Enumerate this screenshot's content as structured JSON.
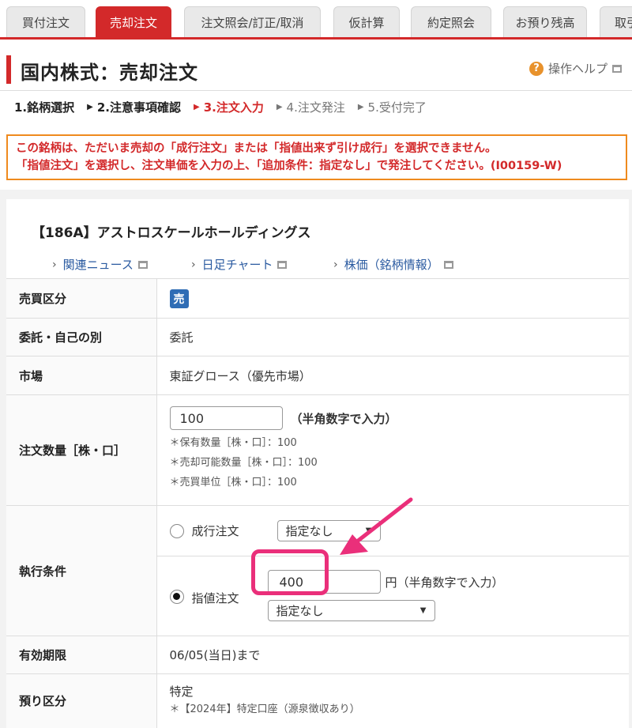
{
  "tabs": [
    {
      "label": "買付注文",
      "active": false
    },
    {
      "label": "売却注文",
      "active": true
    },
    {
      "label": "注文照会/訂正/取消",
      "active": false
    },
    {
      "label": "仮計算",
      "active": false
    },
    {
      "label": "約定照会",
      "active": false
    },
    {
      "label": "お預り残高",
      "active": false
    },
    {
      "label": "取引",
      "active": false
    }
  ],
  "page_title": "国内株式：売却注文",
  "help_label": "操作ヘルプ",
  "steps": [
    {
      "label": "1.銘柄選択",
      "state": "done"
    },
    {
      "label": "2.注意事項確認",
      "state": "done"
    },
    {
      "label": "3.注文入力",
      "state": "current"
    },
    {
      "label": "4.注文発注",
      "state": "todo"
    },
    {
      "label": "5.受付完了",
      "state": "todo"
    }
  ],
  "alert": {
    "line1": "この銘柄は、ただいま売却の「成行注文」または「指値出来ず引け成行」を選択できません。",
    "line2": "「指値注文」を選択し、注文単価を入力の上、「追加条件：指定なし」で発注してください。(I00159-W)"
  },
  "stock": {
    "name": "【186A】アストロスケールホールディングス",
    "links": [
      "関連ニュース",
      "日足チャート",
      "株価（銘柄情報）"
    ]
  },
  "form": {
    "side_label": "売買区分",
    "side_badge": "売",
    "account_type_label": "委託・自己の別",
    "account_type_value": "委託",
    "market_label": "市場",
    "market_value": "東証グロース（優先市場）",
    "quantity_label": "注文数量［株・口］",
    "quantity_value": "100",
    "quantity_hint": "（半角数字で入力）",
    "quantity_notes": [
      "＊保有数量［株・口］：100",
      "＊売却可能数量［株・口］：100",
      "＊売買単位［株・口］：100"
    ],
    "exec_label": "執行条件",
    "market_order_label": "成行注文",
    "market_order_select": "指定なし",
    "limit_order_label": "指値注文",
    "limit_price_value": "400",
    "limit_unit": "円（半角数字で入力）",
    "limit_order_select": "指定なし",
    "expiry_label": "有効期限",
    "expiry_value": "06/05(当日)まで",
    "custody_label": "預り区分",
    "custody_value": "特定",
    "custody_note": "＊【2024年】特定口座（源泉徴収あり）"
  },
  "colors": {
    "accent_red": "#d3292a",
    "alert_border": "#ef8a1e",
    "link_blue": "#2a5aa0",
    "annotation_pink": "#ea2f7a"
  }
}
